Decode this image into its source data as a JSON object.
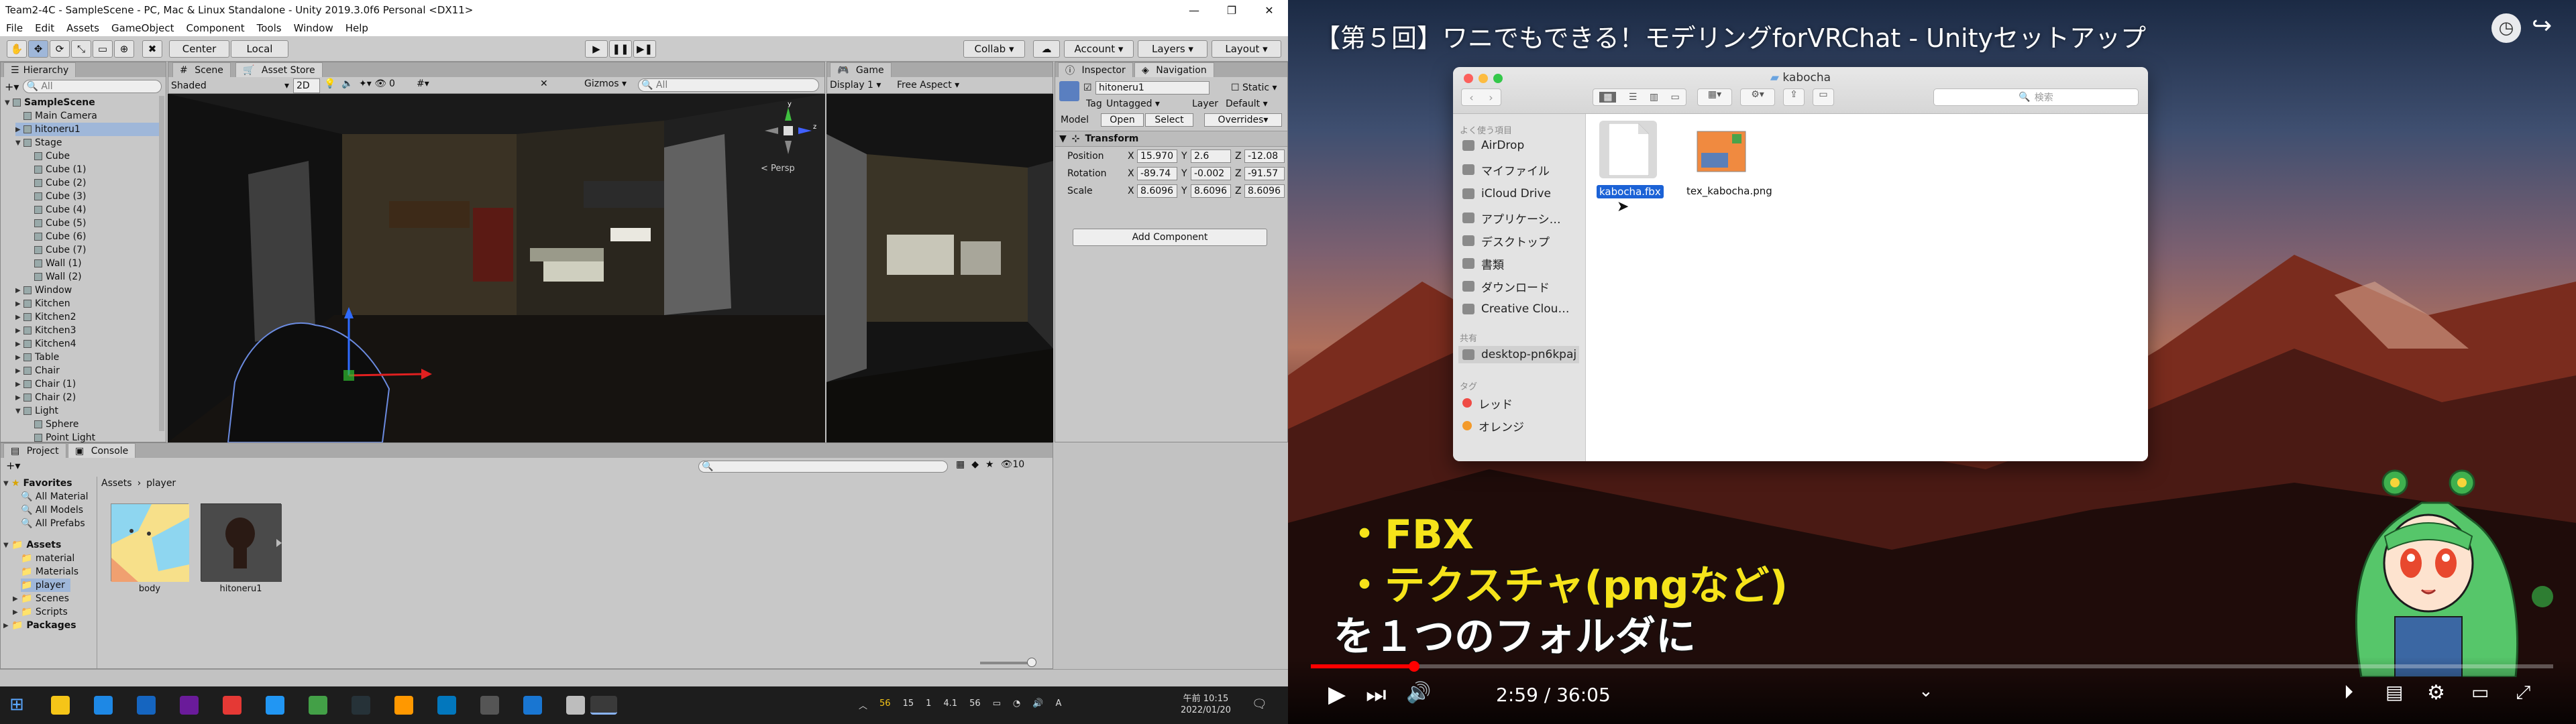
{
  "unity": {
    "window_title": "Team2-4C - SampleScene - PC, Mac & Linux Standalone - Unity 2019.3.0f6 Personal <DX11>",
    "menu": [
      "File",
      "Edit",
      "Assets",
      "GameObject",
      "Component",
      "Tools",
      "Window",
      "Help"
    ],
    "toolbar": {
      "pivot": "Center",
      "space": "Local",
      "collab": "Collab",
      "account": "Account",
      "layers": "Layers",
      "layout": "Layout"
    },
    "hierarchy": {
      "tab": "Hierarchy",
      "search_placeholder": "All",
      "items": [
        {
          "label": "SampleScene",
          "depth": 0,
          "fold": "▼",
          "bold": true
        },
        {
          "label": "Main Camera",
          "depth": 1,
          "fold": ""
        },
        {
          "label": "hitoneru1",
          "depth": 1,
          "fold": "▶"
        },
        {
          "label": "Stage",
          "depth": 1,
          "fold": "▼"
        },
        {
          "label": "Cube",
          "depth": 2,
          "fold": ""
        },
        {
          "label": "Cube (1)",
          "depth": 2,
          "fold": ""
        },
        {
          "label": "Cube (2)",
          "depth": 2,
          "fold": ""
        },
        {
          "label": "Cube (3)",
          "depth": 2,
          "fold": ""
        },
        {
          "label": "Cube (4)",
          "depth": 2,
          "fold": ""
        },
        {
          "label": "Cube (5)",
          "depth": 2,
          "fold": ""
        },
        {
          "label": "Cube (6)",
          "depth": 2,
          "fold": ""
        },
        {
          "label": "Cube (7)",
          "depth": 2,
          "fold": ""
        },
        {
          "label": "Wall (1)",
          "depth": 2,
          "fold": ""
        },
        {
          "label": "Wall (2)",
          "depth": 2,
          "fold": ""
        },
        {
          "label": "Window",
          "depth": 1,
          "fold": "▶"
        },
        {
          "label": "Kitchen",
          "depth": 1,
          "fold": "▶"
        },
        {
          "label": "Kitchen2",
          "depth": 1,
          "fold": "▶"
        },
        {
          "label": "Kitchen3",
          "depth": 1,
          "fold": "▶"
        },
        {
          "label": "Kitchen4",
          "depth": 1,
          "fold": "▶"
        },
        {
          "label": "Table",
          "depth": 1,
          "fold": "▶"
        },
        {
          "label": "Chair",
          "depth": 1,
          "fold": "▶"
        },
        {
          "label": "Chair (1)",
          "depth": 1,
          "fold": "▶"
        },
        {
          "label": "Chair (2)",
          "depth": 1,
          "fold": "▶"
        },
        {
          "label": "Light",
          "depth": 1,
          "fold": "▼"
        },
        {
          "label": "Sphere",
          "depth": 2,
          "fold": ""
        },
        {
          "label": "Point Light",
          "depth": 2,
          "fold": ""
        }
      ]
    },
    "scene": {
      "tab_scene": "Scene",
      "tab_asset_store": "Asset Store",
      "shading": "Shaded",
      "mode_2d": "2D",
      "gizmos": "Gizmos",
      "search_placeholder": "All",
      "persp": "< Persp",
      "fx_count": "0"
    },
    "game": {
      "tab": "Game",
      "display": "Display 1",
      "aspect": "Free Aspect"
    },
    "inspector": {
      "tab_inspector": "Inspector",
      "tab_navigation": "Navigation",
      "object_name": "hitoneru1",
      "static_label": "Static",
      "tag_label": "Tag",
      "tag_value": "Untagged",
      "layer_label": "Layer",
      "layer_value": "Default",
      "model_label": "Model",
      "open_btn": "Open",
      "select_btn": "Select",
      "overrides_btn": "Overrides",
      "transform_title": "Transform",
      "position": {
        "label": "Position",
        "x": "15.970",
        "y": "2.6",
        "z": "-12.08"
      },
      "rotation": {
        "label": "Rotation",
        "x": "-89.74",
        "y": "-0.002",
        "z": "-91.57"
      },
      "scale": {
        "label": "Scale",
        "x": "8.6096",
        "y": "8.6096",
        "z": "8.6096"
      },
      "add_component": "Add Component"
    },
    "project": {
      "tab_project": "Project",
      "tab_console": "Console",
      "favorites_label": "Favorites",
      "favorites": [
        "All Material",
        "All Models",
        "All Prefabs"
      ],
      "assets_label": "Assets",
      "asset_folders": [
        "material",
        "Materials",
        "player",
        "Scenes",
        "Scripts"
      ],
      "packages_label": "Packages",
      "breadcrumb_root": "Assets",
      "breadcrumb_sep": "›",
      "breadcrumb_leaf": "player",
      "files": [
        {
          "label": "body"
        },
        {
          "label": "hitoneru1"
        }
      ],
      "count": "10"
    },
    "taskbar": {
      "time": "午前 10:15",
      "date": "2022/01/20",
      "ime": "A",
      "tray_nums": [
        "56",
        "15",
        "1",
        "4.1",
        "56"
      ]
    }
  },
  "youtube": {
    "title": "【第５回】ワニでもできる！モデリングforVRChat - Unityセットアップ",
    "finder": {
      "folder": "kabocha",
      "search_placeholder": "検索",
      "section_favorites": "よく使う項目",
      "favorites": [
        "AirDrop",
        "マイファイル",
        "iCloud Drive",
        "アプリケーシ…",
        "デスクトップ",
        "書類",
        "ダウンロード",
        "Creative Clou…"
      ],
      "section_shared": "共有",
      "shared": [
        "desktop-pn6kpaj"
      ],
      "section_tags": "タグ",
      "tags": [
        {
          "label": "レッド",
          "color": "#ef4b45"
        },
        {
          "label": "オレンジ",
          "color": "#f39a2b"
        }
      ],
      "files": [
        {
          "label": "kabocha.fbx",
          "selected": true
        },
        {
          "label": "tex_kabocha.png",
          "selected": false
        }
      ]
    },
    "subtitles": {
      "line1": "・FBX",
      "line2": "・テクスチャ(pngなど)",
      "line3": "を１つのフォルダに"
    },
    "player": {
      "time": "2:59 / 36:05",
      "progress": 0.083
    }
  }
}
